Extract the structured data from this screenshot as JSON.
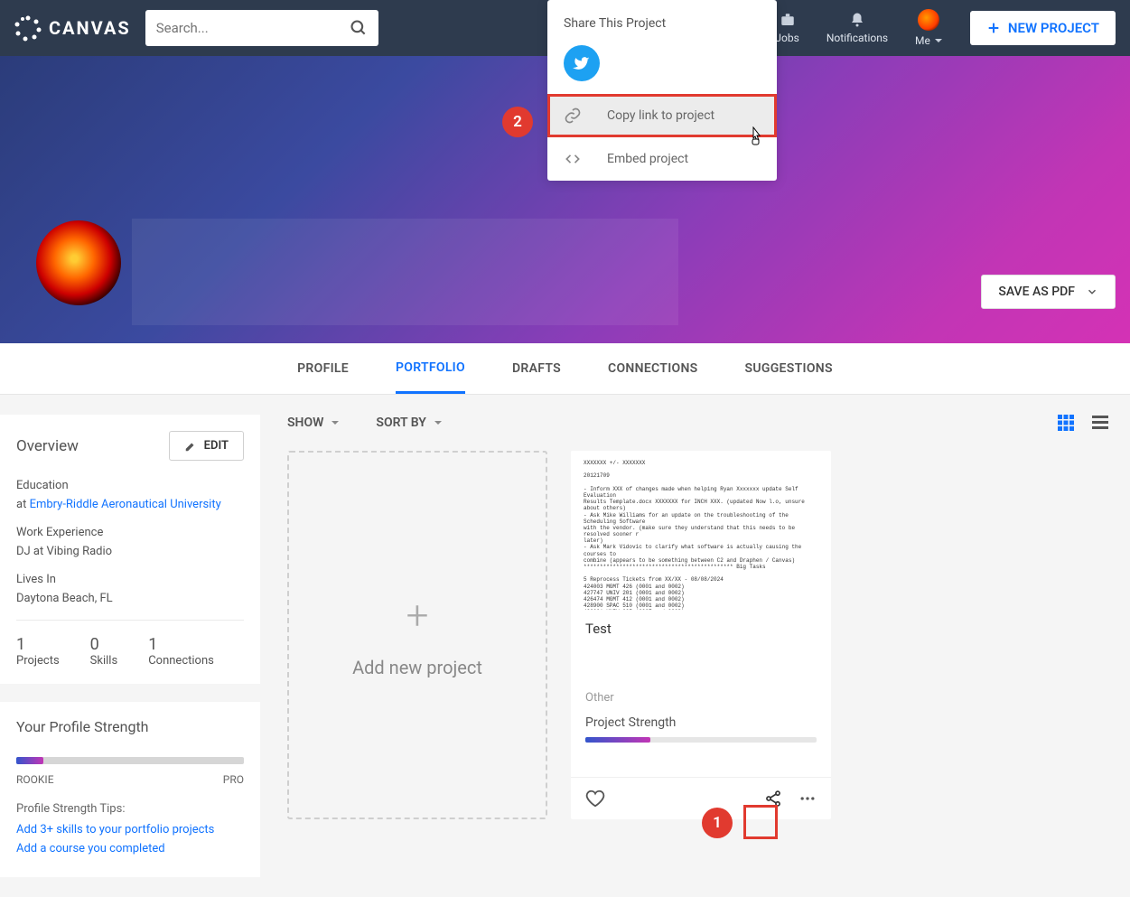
{
  "header": {
    "brand": "CANVAS",
    "search_placeholder": "Search...",
    "nav": {
      "jobs": "Jobs",
      "notifications": "Notifications",
      "me": "Me"
    },
    "new_project": "NEW PROJECT"
  },
  "banner": {
    "save_pdf": "SAVE AS PDF"
  },
  "tabs": {
    "profile": "PROFILE",
    "portfolio": "PORTFOLIO",
    "drafts": "DRAFTS",
    "connections": "CONNECTIONS",
    "suggestions": "SUGGESTIONS"
  },
  "overview": {
    "title": "Overview",
    "edit": "EDIT",
    "edu_label": "Education",
    "edu_prefix": "at ",
    "edu_link": "Embry-Riddle Aeronautical University",
    "work_label": "Work Experience",
    "work_val": "DJ at Vibing Radio",
    "lives_label": "Lives In",
    "lives_val": "Daytona Beach, FL",
    "stats": {
      "projects_n": "1",
      "projects_l": "Projects",
      "skills_n": "0",
      "skills_l": "Skills",
      "conn_n": "1",
      "conn_l": "Connections"
    }
  },
  "strength": {
    "title": "Your Profile Strength",
    "low": "ROOKIE",
    "high": "PRO",
    "tips_label": "Profile Strength Tips:",
    "tip1": "Add 3+ skills to your portfolio projects",
    "tip2": "Add a course you completed"
  },
  "toolbar": {
    "show": "SHOW",
    "sort": "SORT BY"
  },
  "add_card": {
    "label": "Add new project"
  },
  "project": {
    "title": "Test",
    "category": "Other",
    "strength_label": "Project Strength"
  },
  "share": {
    "title": "Share This Project",
    "copy": "Copy link to project",
    "embed": "Embed project"
  },
  "annot": {
    "one": "1",
    "two": "2"
  }
}
